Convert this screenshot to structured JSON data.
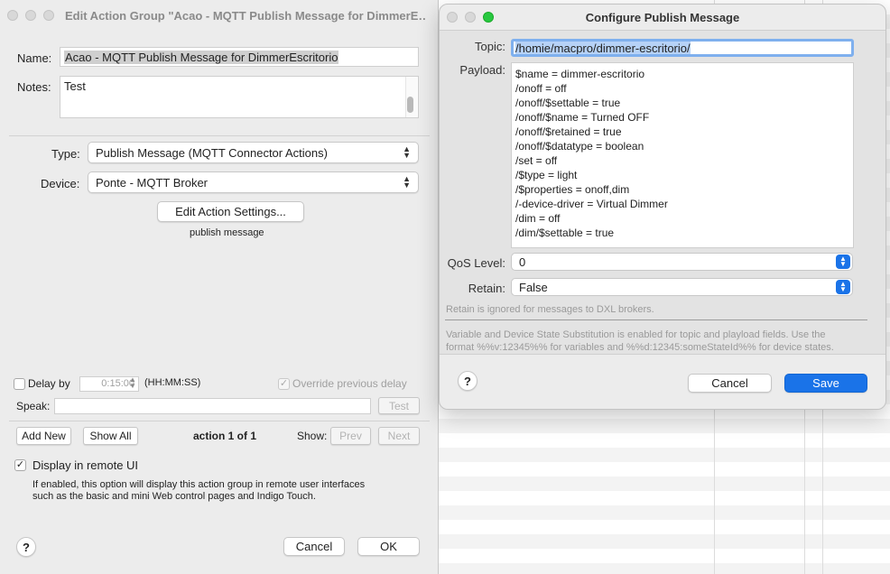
{
  "left_window": {
    "title": "Edit Action Group \"Acao - MQTT Publish Message for DimmerE…",
    "name_label": "Name:",
    "name_value": "Acao - MQTT Publish Message for DimmerEscritorio",
    "notes_label": "Notes:",
    "notes_value": "Test",
    "type_label": "Type:",
    "type_value": "Publish Message (MQTT Connector Actions)",
    "device_label": "Device:",
    "device_value": "Ponte - MQTT Broker",
    "edit_settings_button": "Edit Action Settings...",
    "action_summary": "publish message",
    "delay_label": "Delay by",
    "delay_value": "0:15:00",
    "delay_format": "(HH:MM:SS)",
    "override_label": "Override previous delay",
    "speak_label": "Speak:",
    "speak_value": "",
    "test_button": "Test",
    "add_new_button": "Add New",
    "show_all_button": "Show All",
    "action_counter": "action 1 of 1",
    "show_label": "Show:",
    "prev_button": "Prev",
    "next_button": "Next",
    "display_remote_label": "Display in remote UI",
    "display_remote_desc_1": "If enabled, this option will display this action group in remote user interfaces",
    "display_remote_desc_2": "such as the basic and mini Web control pages and Indigo Touch.",
    "help_button": "?",
    "cancel_button": "Cancel",
    "ok_button": "OK"
  },
  "right_window": {
    "title": "Configure Publish Message",
    "topic_label": "Topic:",
    "topic_value": "/homie/macpro/dimmer-escritorio/",
    "payload_label": "Payload:",
    "payload_lines": [
      "$name = dimmer-escritorio",
      "/onoff = off",
      "/onoff/$settable = true",
      "/onoff/$name = Turned OFF",
      "/onoff/$retained = true",
      "/onoff/$datatype = boolean",
      "/set = off",
      "/$type = light",
      "/$properties = onoff,dim",
      "/-device-driver = Virtual Dimmer",
      "/dim = off",
      "/dim/$settable = true"
    ],
    "qos_label": "QoS Level:",
    "qos_value": "0",
    "retain_label": "Retain:",
    "retain_value": "False",
    "retain_note": "Retain is ignored for messages to DXL brokers.",
    "substitution_note_1": "Variable and Device State Substitution is enabled for topic and playload fields. Use the",
    "substitution_note_2": "format %%v:12345%% for variables and %%d:12345:someStateId%% for device states.",
    "help_button": "?",
    "cancel_button": "Cancel",
    "save_button": "Save"
  },
  "colors": {
    "accent": "#1a73e8",
    "window_bg": "#ececec"
  }
}
